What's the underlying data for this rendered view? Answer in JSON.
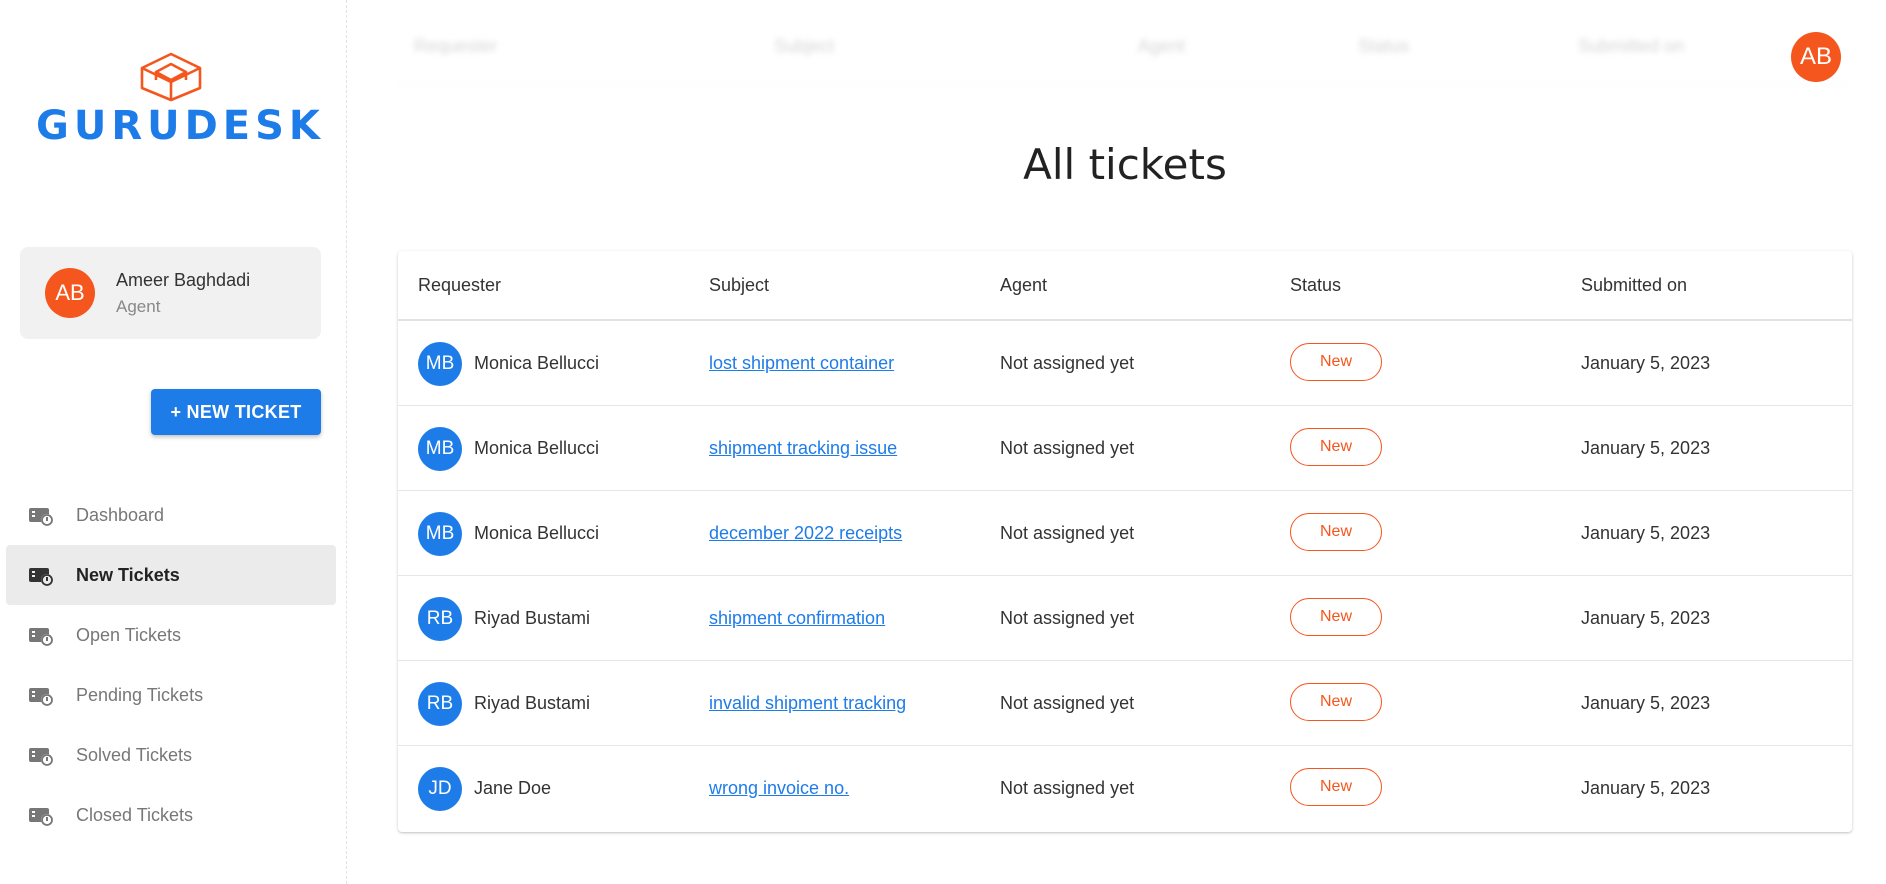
{
  "brand": {
    "name": "GURUDESK",
    "logo_icon": "isometric-cube-icon",
    "logo_color": "#f5561d",
    "text_color": "#1e7ce8"
  },
  "user": {
    "initials": "AB",
    "name": "Ameer Baghdadi",
    "role": "Agent"
  },
  "actions": {
    "new_ticket_label": "+ NEW TICKET"
  },
  "nav": {
    "items": [
      {
        "label": "Dashboard",
        "icon": "ticket-icon",
        "active": false
      },
      {
        "label": "New Tickets",
        "icon": "ticket-icon",
        "active": true
      },
      {
        "label": "Open Tickets",
        "icon": "ticket-icon",
        "active": false
      },
      {
        "label": "Pending Tickets",
        "icon": "ticket-icon",
        "active": false
      },
      {
        "label": "Solved Tickets",
        "icon": "ticket-icon",
        "active": false
      },
      {
        "label": "Closed Tickets",
        "icon": "ticket-icon",
        "active": false
      }
    ]
  },
  "header": {
    "avatar_initials": "AB"
  },
  "page": {
    "title": "All tickets"
  },
  "table": {
    "columns": [
      "Requester",
      "Subject",
      "Agent",
      "Status",
      "Submitted on"
    ],
    "rows": [
      {
        "initials": "MB",
        "requester": "Monica Bellucci",
        "subject": "lost shipment container",
        "agent": "Not assigned yet",
        "status": "New",
        "submitted": "January 5, 2023"
      },
      {
        "initials": "MB",
        "requester": "Monica Bellucci",
        "subject": "shipment tracking issue",
        "agent": "Not assigned yet",
        "status": "New",
        "submitted": "January 5, 2023"
      },
      {
        "initials": "MB",
        "requester": "Monica Bellucci",
        "subject": "december 2022 receipts",
        "agent": "Not assigned yet",
        "status": "New",
        "submitted": "January 5, 2023"
      },
      {
        "initials": "RB",
        "requester": "Riyad Bustami",
        "subject": "shipment confirmation",
        "agent": "Not assigned yet",
        "status": "New",
        "submitted": "January 5, 2023"
      },
      {
        "initials": "RB",
        "requester": "Riyad Bustami",
        "subject": "invalid shipment tracking",
        "agent": "Not assigned yet",
        "status": "New",
        "submitted": "January 5, 2023"
      },
      {
        "initials": "JD",
        "requester": "Jane Doe",
        "subject": "wrong invoice no.",
        "agent": "Not assigned yet",
        "status": "New",
        "submitted": "January 5, 2023"
      }
    ]
  },
  "colors": {
    "accent": "#1e7ce8",
    "orange": "#f5561d"
  }
}
